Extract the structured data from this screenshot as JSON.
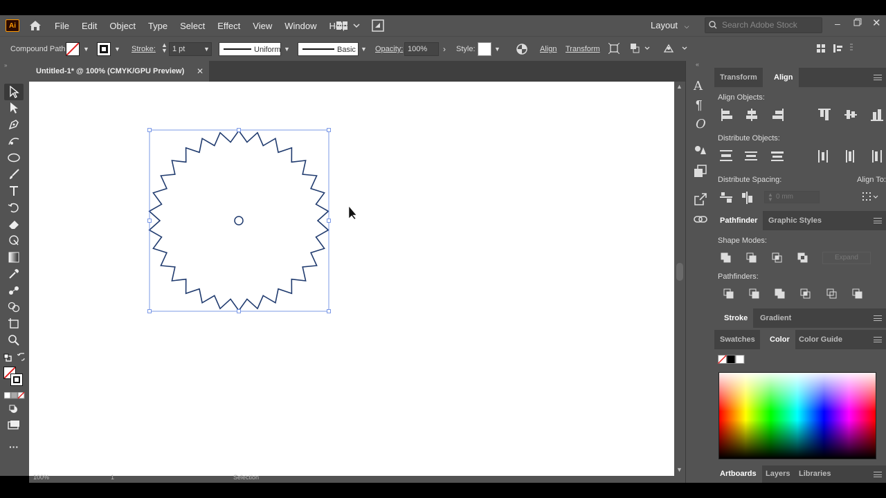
{
  "app": {
    "logo": "Ai"
  },
  "menu": {
    "items": [
      "File",
      "Edit",
      "Object",
      "Type",
      "Select",
      "Effect",
      "View",
      "Window",
      "Help"
    ],
    "layout": "Layout",
    "search_placeholder": "Search Adobe Stock"
  },
  "control": {
    "selection": "Compound Path",
    "stroke_label": "Stroke:",
    "stroke_weight": "1 pt",
    "profile": "Uniform",
    "brush": "Basic",
    "opacity_label": "Opacity:",
    "opacity": "100%",
    "style_label": "Style:",
    "align": "Align",
    "transform": "Transform"
  },
  "document": {
    "tab": "Untitled-1* @ 100% (CMYK/GPU Preview)"
  },
  "status": {
    "zoom": "100%",
    "artboard": "1",
    "tool": "Selection"
  },
  "align_panel": {
    "tabs": [
      "Transform",
      "Align"
    ],
    "align_objects": "Align Objects:",
    "distribute_objects": "Distribute Objects:",
    "distribute_spacing": "Distribute Spacing:",
    "align_to": "Align To:",
    "spacing_value": "0 mm"
  },
  "pathfinder_panel": {
    "tabs": [
      "Pathfinder",
      "Graphic Styles"
    ],
    "shape_modes": "Shape Modes:",
    "pathfinders": "Pathfinders:",
    "expand": "Expand"
  },
  "stroke_panel": {
    "tabs": [
      "Stroke",
      "Gradient"
    ]
  },
  "color_panel": {
    "tabs": [
      "Swatches",
      "Color",
      "Color Guide"
    ]
  },
  "bottom_panel": {
    "tabs": [
      "Artboards",
      "Layers",
      "Libraries"
    ]
  },
  "colors": {
    "ui": "#535353",
    "dark": "#424242",
    "selection": "#4a7ae0",
    "path": "#1f3a6e"
  },
  "shape": {
    "type": "star-burst",
    "points": 30
  }
}
